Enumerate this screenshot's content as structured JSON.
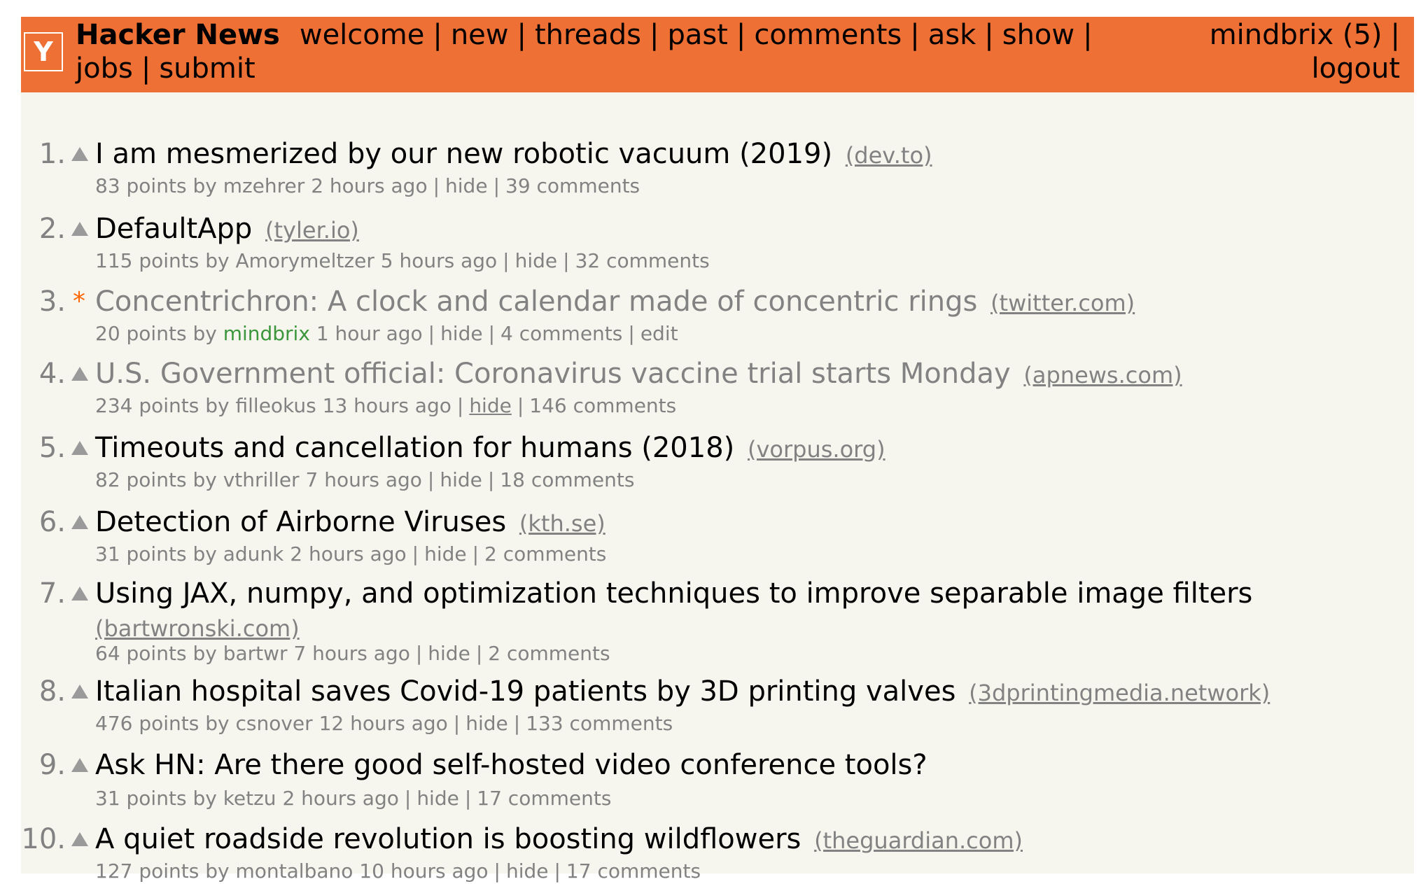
{
  "header": {
    "logo_letter": "Y",
    "site_name": "Hacker News",
    "nav": [
      "welcome",
      "new",
      "threads",
      "past",
      "comments",
      "ask",
      "show",
      "jobs",
      "submit"
    ],
    "user": "mindbrix (5)",
    "logout": "logout",
    "bar_color": "#ee7034"
  },
  "stories": [
    {
      "rank": "1.",
      "title": "I am mesmerized by our new robotic vacuum (2019)",
      "domain": "(dev.to)",
      "points": "83 points",
      "by": "by",
      "user": "mzehrer",
      "age": "2 hours ago",
      "hide": "hide",
      "comments": "39 comments"
    },
    {
      "rank": "2.",
      "title": "DefaultApp",
      "domain": "(tyler.io)",
      "points": "115 points",
      "by": "by",
      "user": "Amorymeltzer",
      "age": "5 hours ago",
      "hide": "hide",
      "comments": "32 comments"
    },
    {
      "rank": "3.",
      "title": "Concentrichron: A clock and calendar made of concentric rings",
      "domain": "(twitter.com)",
      "points": "20 points",
      "by": "by",
      "user": "mindbrix",
      "age": "1 hour ago",
      "hide": "hide",
      "comments": "4 comments",
      "edit": "edit",
      "own_marker": "*"
    },
    {
      "rank": "4.",
      "title": "U.S. Government official: Coronavirus vaccine trial starts Monday",
      "domain": "(apnews.com)",
      "points": "234 points",
      "by": "by",
      "user": "filleokus",
      "age": "13 hours ago",
      "hide": "hide",
      "comments": "146 comments"
    },
    {
      "rank": "5.",
      "title": "Timeouts and cancellation for humans (2018)",
      "domain": "(vorpus.org)",
      "points": "82 points",
      "by": "by",
      "user": "vthriller",
      "age": "7 hours ago",
      "hide": "hide",
      "comments": "18 comments"
    },
    {
      "rank": "6.",
      "title": "Detection of Airborne Viruses",
      "domain": "(kth.se)",
      "points": "31 points",
      "by": "by",
      "user": "adunk",
      "age": "2 hours ago",
      "hide": "hide",
      "comments": "2 comments"
    },
    {
      "rank": "7.",
      "title": "Using JAX, numpy, and optimization techniques to improve separable image filters",
      "domain": "(bartwronski.com)",
      "points": "64 points",
      "by": "by",
      "user": "bartwr",
      "age": "7 hours ago",
      "hide": "hide",
      "comments": "2 comments"
    },
    {
      "rank": "8.",
      "title": "Italian hospital saves Covid-19 patients by 3D printing valves",
      "domain": "(3dprintingmedia.network)",
      "points": "476 points",
      "by": "by",
      "user": "csnover",
      "age": "12 hours ago",
      "hide": "hide",
      "comments": "133 comments"
    },
    {
      "rank": "9.",
      "title": "Ask HN: Are there good self-hosted video conference tools?",
      "domain": "",
      "points": "31 points",
      "by": "by",
      "user": "ketzu",
      "age": "2 hours ago",
      "hide": "hide",
      "comments": "17 comments"
    },
    {
      "rank": "10.",
      "title": "A quiet roadside revolution is boosting wildflowers",
      "domain": "(theguardian.com)",
      "points": "127 points",
      "by": "by",
      "user": "montalbano",
      "age": "10 hours ago",
      "hide": "hide",
      "comments": "17 comments"
    }
  ]
}
